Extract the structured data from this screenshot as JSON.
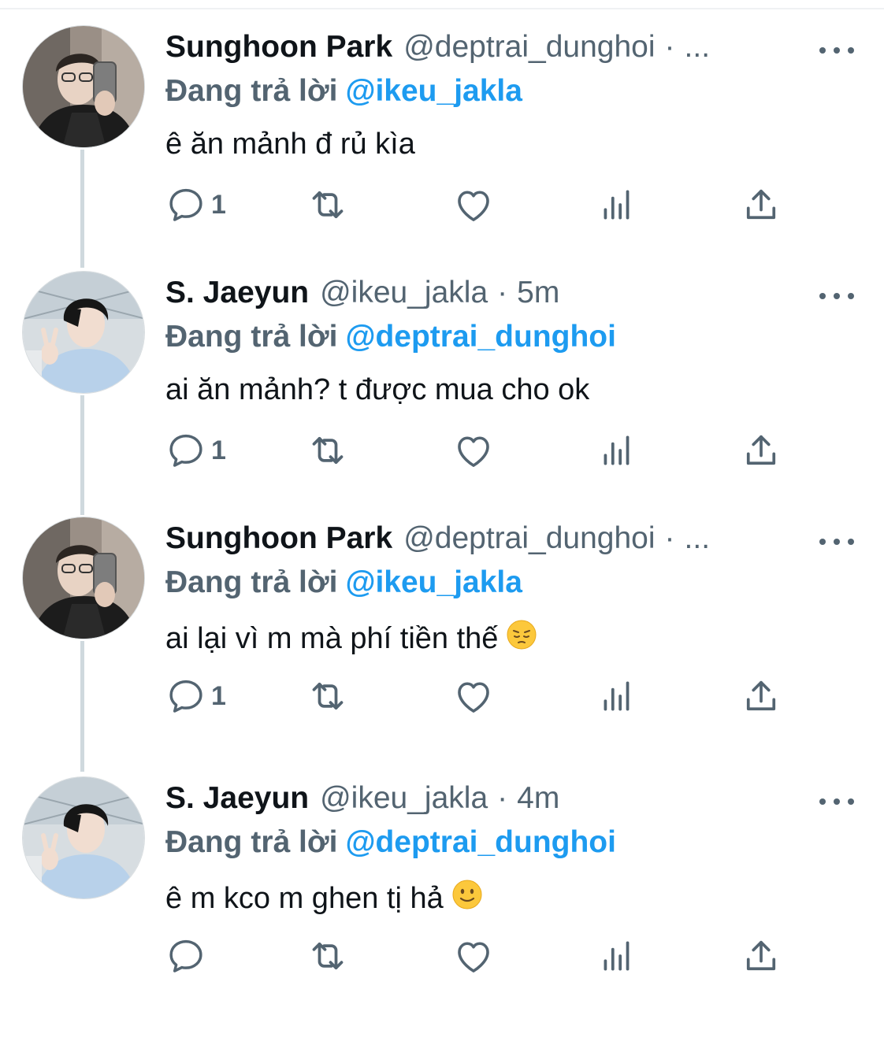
{
  "colors": {
    "name": "#0f1419",
    "secondary": "#536471",
    "mention": "#1d9bf0",
    "thread_line": "#cfd9de"
  },
  "tweets": [
    {
      "author": "Sunghoon Park",
      "handle": "@deptrai_dunghoi",
      "separator": "·",
      "time": "...",
      "replying_label": "Đang trả lời",
      "replying_to": "@ikeu_jakla",
      "text": "ê ăn mảnh đ rủ kìa",
      "emoji": "",
      "reply_count": "1",
      "avatar": "avatar-sunghoon"
    },
    {
      "author": "S. Jaeyun",
      "handle": "@ikeu_jakla",
      "separator": "·",
      "time": "5m",
      "replying_label": "Đang trả lời",
      "replying_to": "@deptrai_dunghoi",
      "text": "ai ăn mảnh? t được mua cho ok",
      "emoji": "",
      "reply_count": "1",
      "avatar": "avatar-jaeyun"
    },
    {
      "author": "Sunghoon Park",
      "handle": "@deptrai_dunghoi",
      "separator": "·",
      "time": "...",
      "replying_label": "Đang trả lời",
      "replying_to": "@ikeu_jakla",
      "text": "ai lại vì m mà phí tiền thế",
      "emoji": "pensive-face",
      "reply_count": "1",
      "avatar": "avatar-sunghoon"
    },
    {
      "author": "S. Jaeyun",
      "handle": "@ikeu_jakla",
      "separator": "·",
      "time": "4m",
      "replying_label": "Đang trả lời",
      "replying_to": "@deptrai_dunghoi",
      "text": "ê m kco m ghen tị hả",
      "emoji": "slightly-smiling-face",
      "reply_count": "",
      "avatar": "avatar-jaeyun"
    }
  ]
}
